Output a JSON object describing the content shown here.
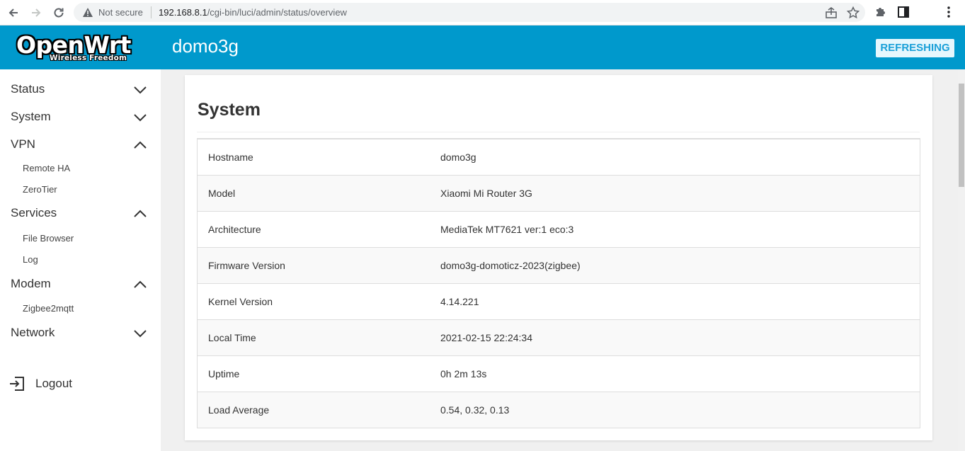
{
  "browser": {
    "security_label": "Not secure",
    "url_host": "192.168.8.1",
    "url_path": "/cgi-bin/luci/admin/status/overview"
  },
  "header": {
    "brand_main": "OpenWrt",
    "brand_tagline": "Wireless Freedom",
    "hostname": "domo3g",
    "status_badge": "REFRESHING"
  },
  "sidebar": {
    "items": [
      {
        "label": "Status",
        "expanded": false
      },
      {
        "label": "System",
        "expanded": false
      },
      {
        "label": "VPN",
        "expanded": true,
        "children": [
          "Remote HA",
          "ZeroTier"
        ]
      },
      {
        "label": "Services",
        "expanded": true,
        "children": [
          "File Browser",
          "Log"
        ]
      },
      {
        "label": "Modem",
        "expanded": true,
        "children": [
          "Zigbee2mqtt"
        ]
      },
      {
        "label": "Network",
        "expanded": false
      }
    ],
    "logout_label": "Logout"
  },
  "main": {
    "section_title": "System",
    "rows": [
      {
        "key": "Hostname",
        "value": "domo3g"
      },
      {
        "key": "Model",
        "value": "Xiaomi Mi Router 3G"
      },
      {
        "key": "Architecture",
        "value": "MediaTek MT7621 ver:1 eco:3"
      },
      {
        "key": "Firmware Version",
        "value": "domo3g-domoticz-2023(zigbee)"
      },
      {
        "key": "Kernel Version",
        "value": "4.14.221"
      },
      {
        "key": "Local Time",
        "value": "2021-02-15 22:24:34"
      },
      {
        "key": "Uptime",
        "value": "0h 2m 13s"
      },
      {
        "key": "Load Average",
        "value": "0.54, 0.32, 0.13"
      }
    ]
  },
  "colors": {
    "header_bg": "#0099cc",
    "badge_bg": "#e6f7fd",
    "badge_text": "#1aa0d8",
    "content_bg": "#f0f0f0"
  }
}
